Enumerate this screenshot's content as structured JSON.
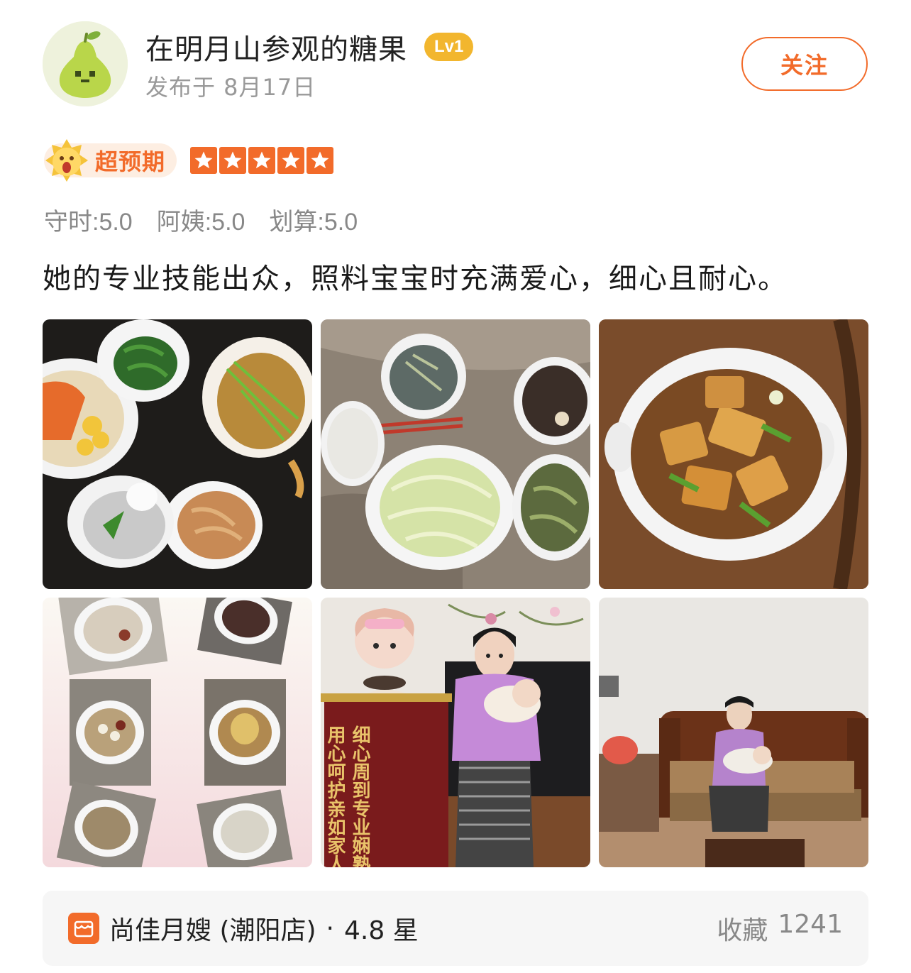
{
  "header": {
    "username": "在明月山参观的糖果",
    "level": "Lv1",
    "publish_date": "发布于 8月17日",
    "follow_label": "关注"
  },
  "rating": {
    "overall_label": "超预期",
    "stars": 5,
    "scores": [
      "守时:5.0",
      "阿姨:5.0",
      "划算:5.0"
    ]
  },
  "review": {
    "text": "她的专业技能出众，照料宝宝时充满爱心，细心且耐心。"
  },
  "photos": [
    {
      "name": "photo-dishes-fish"
    },
    {
      "name": "photo-dishes-rice"
    },
    {
      "name": "photo-tofu-stew"
    },
    {
      "name": "photo-soups-collage"
    },
    {
      "name": "photo-banner-portrait"
    },
    {
      "name": "photo-sofa-baby"
    }
  ],
  "banner": {
    "left_col": "用心呵护亲如家人",
    "right_col": "细心周到专业娴熟"
  },
  "shop": {
    "name": "尚佳月嫂 (潮阳店)",
    "dot": "·",
    "rating": "4.8 星",
    "fav_label": "收藏",
    "fav_count": "1241"
  },
  "colors": {
    "accent": "#f26b2a",
    "level_badge": "#f2b62e",
    "muted_text": "#888888"
  },
  "icons": {
    "avatar": "pear-avatar",
    "exceed": "surprised-face-icon",
    "star": "star-icon",
    "shop": "store-icon"
  }
}
